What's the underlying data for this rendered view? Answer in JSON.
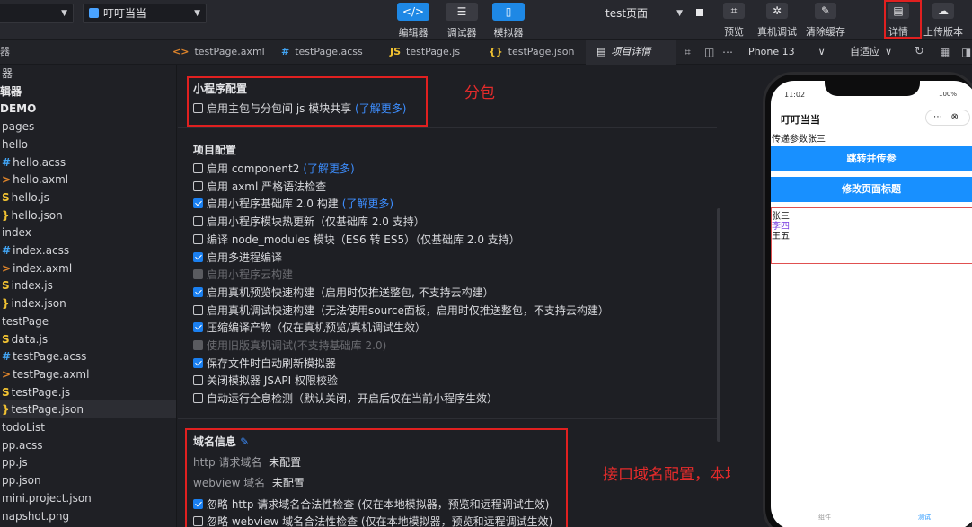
{
  "toolbar": {
    "mode_select": "",
    "project_select": "叮叮当当",
    "btn_editor": "编辑器",
    "btn_debugger": "调试器",
    "btn_simulator": "模拟器",
    "compile_select": "test页面",
    "btn_preview": "预览",
    "btn_real_debug": "真机调试",
    "btn_clear_cache": "清除缓存",
    "btn_details": "详情",
    "btn_upload": "上传版本"
  },
  "tabs": [
    {
      "icon": "<>",
      "label": "testPage.axml"
    },
    {
      "icon": "#",
      "label": "testPage.acss"
    },
    {
      "icon": "JS",
      "label": "testPage.js"
    },
    {
      "icon": "{}",
      "label": "testPage.json"
    },
    {
      "icon": "▤",
      "label": "项目详情"
    }
  ],
  "sim_bar": {
    "device": "iPhone 13",
    "fit": "自适应"
  },
  "sidebar": {
    "items": [
      {
        "label": "器",
        "indent": 0,
        "icon": "",
        "bold": false
      },
      {
        "label": "辑器",
        "indent": 0,
        "icon": "",
        "bold": true
      },
      {
        "label": "DEMO",
        "indent": 0,
        "icon": "",
        "bold": true
      },
      {
        "label": "pages",
        "indent": 0,
        "icon": "",
        "bold": false
      },
      {
        "label": "hello",
        "indent": 0,
        "icon": "",
        "bold": false
      },
      {
        "label": "hello.acss",
        "indent": 1,
        "icon": "#",
        "bold": false
      },
      {
        "label": "hello.axml",
        "indent": 1,
        "icon": ">",
        "bold": false
      },
      {
        "label": "hello.js",
        "indent": 1,
        "icon": "S",
        "bold": false
      },
      {
        "label": "hello.json",
        "indent": 1,
        "icon": "}",
        "bold": false
      },
      {
        "label": "index",
        "indent": 0,
        "icon": "",
        "bold": false
      },
      {
        "label": "index.acss",
        "indent": 1,
        "icon": "#",
        "bold": false
      },
      {
        "label": "index.axml",
        "indent": 1,
        "icon": ">",
        "bold": false
      },
      {
        "label": "index.js",
        "indent": 1,
        "icon": "S",
        "bold": false
      },
      {
        "label": "index.json",
        "indent": 1,
        "icon": "}",
        "bold": false
      },
      {
        "label": "testPage",
        "indent": 0,
        "icon": "",
        "bold": false
      },
      {
        "label": "data.js",
        "indent": 1,
        "icon": "S",
        "bold": false
      },
      {
        "label": "testPage.acss",
        "indent": 1,
        "icon": "#",
        "bold": false
      },
      {
        "label": "testPage.axml",
        "indent": 1,
        "icon": ">",
        "bold": false
      },
      {
        "label": "testPage.js",
        "indent": 1,
        "icon": "S",
        "bold": false
      },
      {
        "label": "testPage.json",
        "indent": 1,
        "icon": "}",
        "bold": false,
        "selected": true
      },
      {
        "label": "todoList",
        "indent": 0,
        "icon": "",
        "bold": false
      },
      {
        "label": "pp.acss",
        "indent": 0,
        "icon": "",
        "bold": false
      },
      {
        "label": "pp.js",
        "indent": 0,
        "icon": "",
        "bold": false
      },
      {
        "label": "pp.json",
        "indent": 0,
        "icon": "",
        "bold": false
      },
      {
        "label": "mini.project.json",
        "indent": 0,
        "icon": "",
        "bold": false
      },
      {
        "label": "napshot.png",
        "indent": 0,
        "icon": "",
        "bold": false
      }
    ]
  },
  "details": {
    "mini_program_title": "小程序配置",
    "mini_program_row": "启用主包与分包间 js 模块共享",
    "mini_program_link": "(了解更多)",
    "project_title": "项目配置",
    "options": [
      {
        "label": "启用 component2",
        "link": "(了解更多)",
        "state": "off"
      },
      {
        "label": "启用 axml 严格语法检查",
        "link": "",
        "state": "off"
      },
      {
        "label": "启用小程序基础库 2.0 构建",
        "link": "(了解更多)",
        "state": "on"
      },
      {
        "label": "启用小程序模块热更新（仅基础库 2.0 支持）",
        "link": "",
        "state": "off"
      },
      {
        "label": "编译 node_modules 模块（ES6 转 ES5）（仅基础库 2.0 支持）",
        "link": "",
        "state": "off"
      },
      {
        "label": "启用多进程编译",
        "link": "",
        "state": "on"
      },
      {
        "label": "启用小程序云构建",
        "link": "",
        "state": "disabled"
      },
      {
        "label": "启用真机预览快速构建（启用时仅推送整包, 不支持云构建）",
        "link": "",
        "state": "on"
      },
      {
        "label": "启用真机调试快速构建（无法使用source面板，启用时仅推送整包，不支持云构建）",
        "link": "",
        "state": "off"
      },
      {
        "label": "压缩编译产物（仅在真机预览/真机调试生效）",
        "link": "",
        "state": "on"
      },
      {
        "label": "使用旧版真机调试(不支持基础库 2.0)",
        "link": "",
        "state": "disabled"
      },
      {
        "label": "保存文件时自动刷新模拟器",
        "link": "",
        "state": "on"
      },
      {
        "label": "关闭模拟器 JSAPI 权限校验",
        "link": "",
        "state": "off"
      },
      {
        "label": "自动运行全息检测（默认关闭，开启后仅在当前小程序生效）",
        "link": "",
        "state": "off"
      }
    ],
    "domain_title": "域名信息",
    "http_label": "http 请求域名",
    "http_value": "未配置",
    "webview_label": "webview 域名",
    "webview_value": "未配置",
    "ignore_http": "忽略 http 请求域名合法性检查 (仅在本地模拟器，预览和远程调试生效)",
    "ignore_webview": "忽略 webview 域名合法性检查 (仅在本地模拟器，预览和远程调试生效)"
  },
  "annotations": {
    "subpackage": "分包",
    "domain": "接口域名配置，本地开发使用ip时可以忽略域名配置"
  },
  "phone": {
    "time": "11:02",
    "battery": "100%",
    "title": "叮叮当当",
    "param_text": "传递参数张三",
    "btn1": "跳转并传参",
    "btn2": "修改页面标题",
    "names": [
      "张三",
      "李四",
      "王五"
    ],
    "tab1": "组件",
    "tab2": "测试"
  },
  "colors": {
    "accent": "#1e88e5",
    "annotation": "#e02020",
    "link": "#3d8eff",
    "purple_item": "#7a3fe0"
  }
}
